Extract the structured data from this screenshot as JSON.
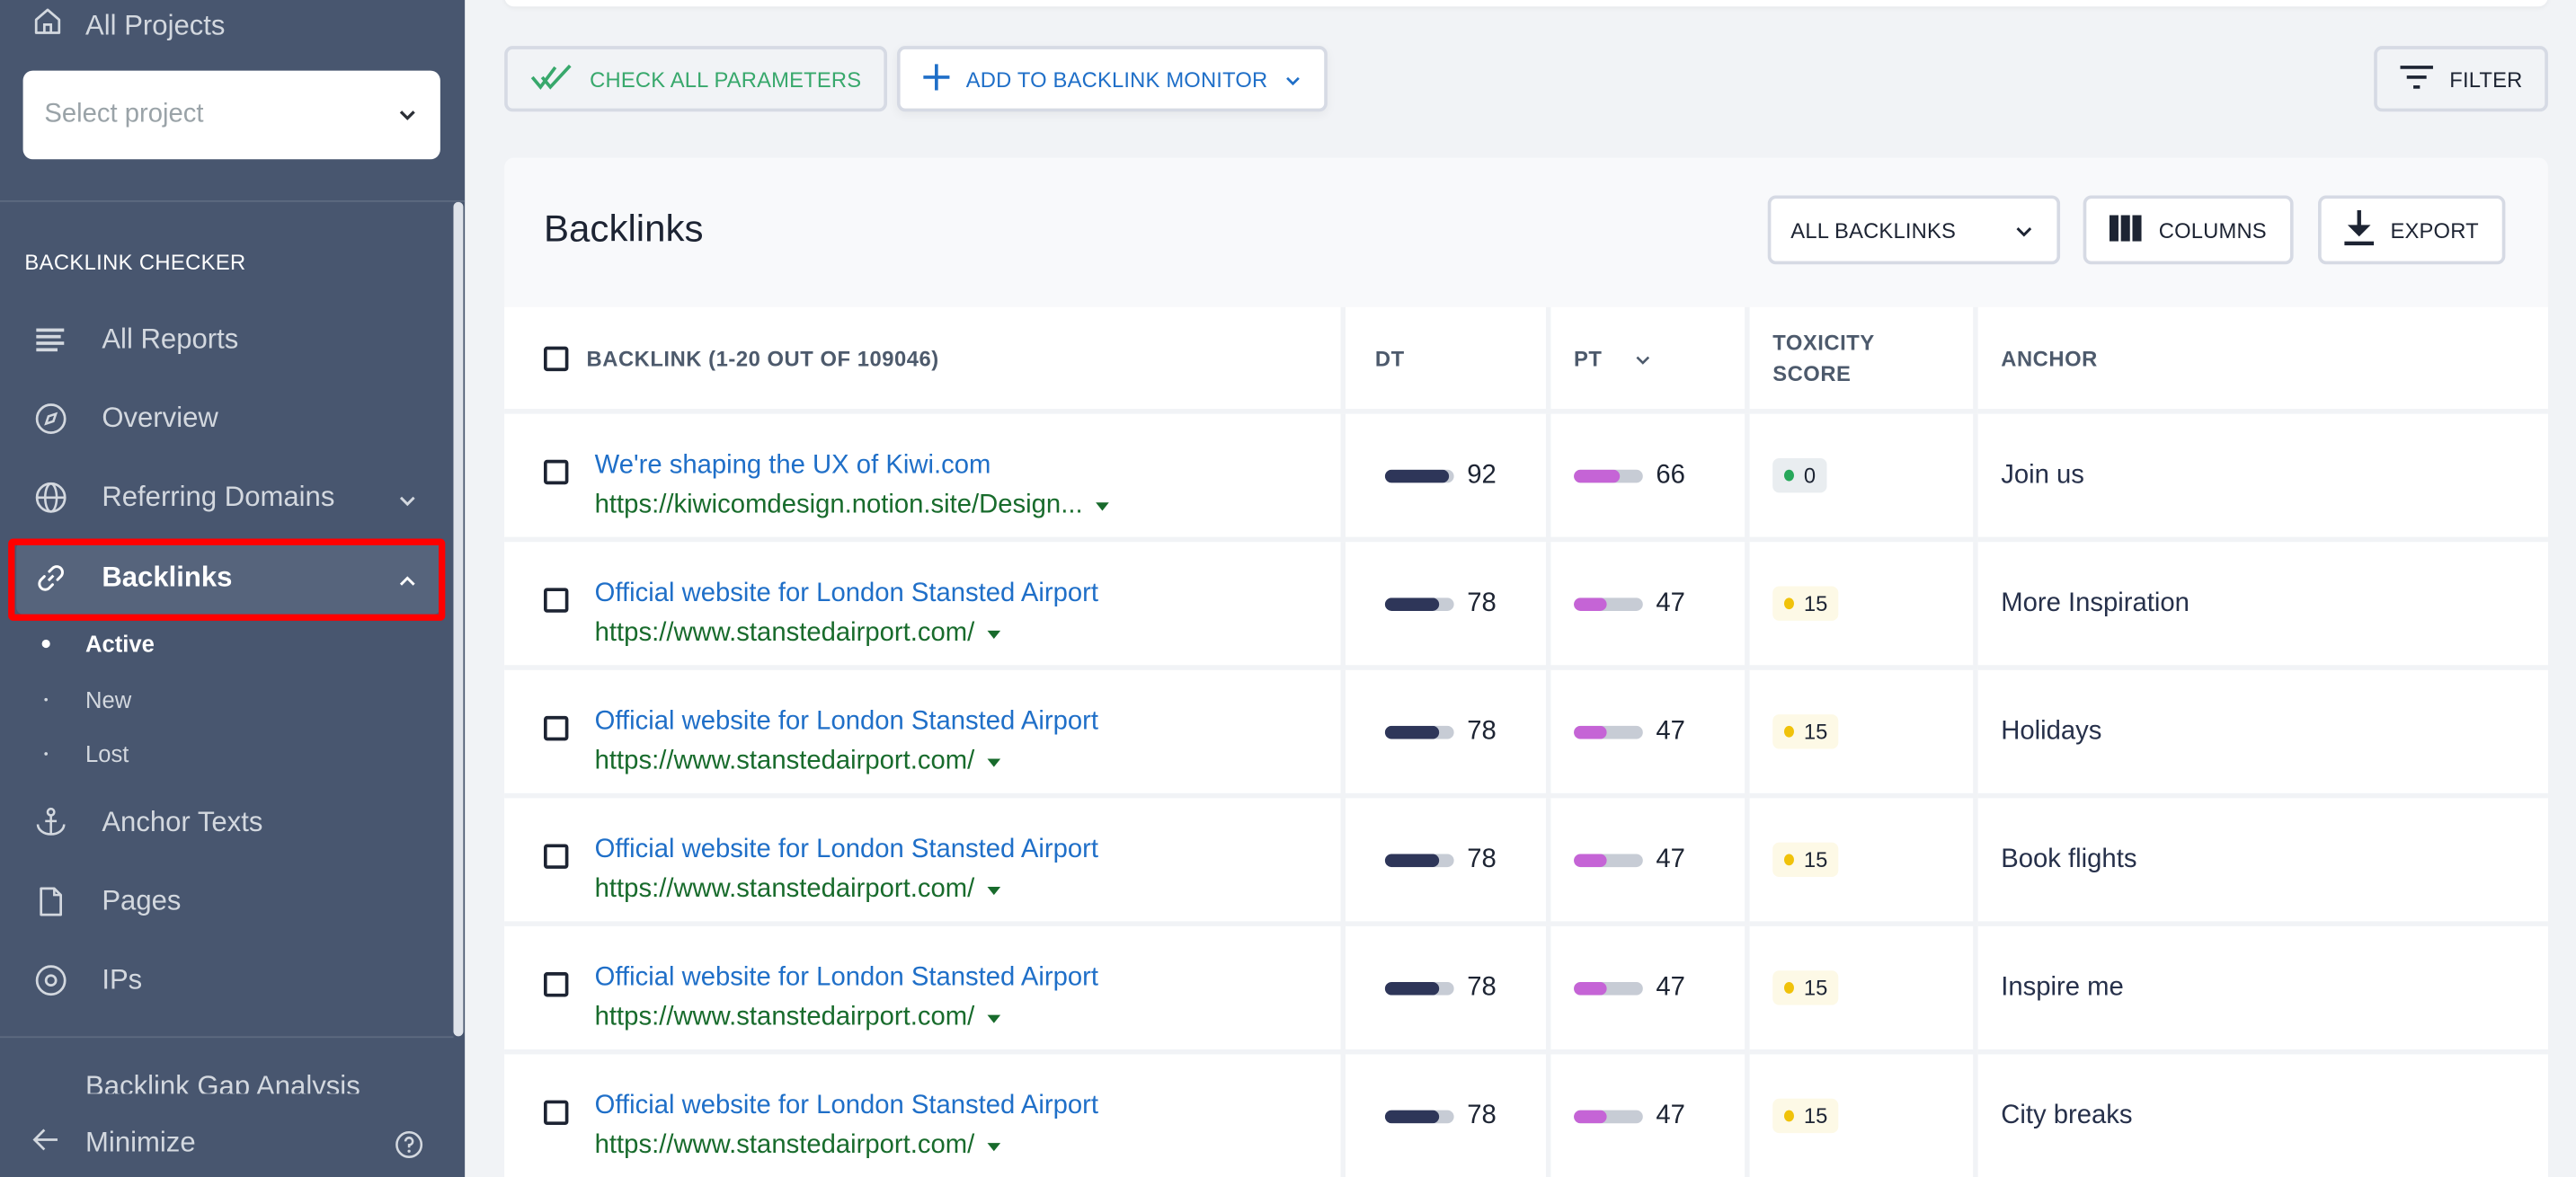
{
  "sidebar": {
    "all_projects": "All Projects",
    "select_project_placeholder": "Select project",
    "section_title": "BACKLINK CHECKER",
    "items": [
      {
        "label": "All Reports",
        "icon": "list-icon"
      },
      {
        "label": "Overview",
        "icon": "compass-icon"
      },
      {
        "label": "Referring Domains",
        "icon": "globe-icon"
      },
      {
        "label": "Backlinks",
        "icon": "link-icon"
      },
      {
        "label": "Anchor Texts",
        "icon": "anchor-icon"
      },
      {
        "label": "Pages",
        "icon": "page-icon"
      },
      {
        "label": "IPs",
        "icon": "target-icon"
      }
    ],
    "sub_items": [
      "Active",
      "New",
      "Lost"
    ],
    "cut_item": "Backlink Gap Analysis",
    "minimize": "Minimize"
  },
  "toolbar": {
    "check_all": "CHECK ALL PARAMETERS",
    "add_monitor": "ADD TO BACKLINK MONITOR",
    "filter": "FILTER"
  },
  "panel": {
    "title": "Backlinks",
    "view_select": "ALL BACKLINKS",
    "columns": "COLUMNS",
    "export": "EXPORT"
  },
  "table": {
    "headers": {
      "backlink": "BACKLINK (1-20 OUT OF 109046)",
      "dt": "DT",
      "pt": "PT",
      "toxicity_1": "TOXICITY",
      "toxicity_2": "SCORE",
      "anchor": "ANCHOR"
    },
    "rows": [
      {
        "title": "We're shaping the UX of Kiwi.com",
        "url": "https://kiwicomdesign.notion.site/Design...",
        "dt": 92,
        "pt": 66,
        "toxicity": "0",
        "tox_level": "green",
        "anchor": "Join us"
      },
      {
        "title": "Official website for London Stansted Airport",
        "url": "https://www.stanstedairport.com/",
        "dt": 78,
        "pt": 47,
        "toxicity": "15",
        "tox_level": "yellow",
        "anchor": "More Inspiration"
      },
      {
        "title": "Official website for London Stansted Airport",
        "url": "https://www.stanstedairport.com/",
        "dt": 78,
        "pt": 47,
        "toxicity": "15",
        "tox_level": "yellow",
        "anchor": "Holidays"
      },
      {
        "title": "Official website for London Stansted Airport",
        "url": "https://www.stanstedairport.com/",
        "dt": 78,
        "pt": 47,
        "toxicity": "15",
        "tox_level": "yellow",
        "anchor": "Book flights"
      },
      {
        "title": "Official website for London Stansted Airport",
        "url": "https://www.stanstedairport.com/",
        "dt": 78,
        "pt": 47,
        "toxicity": "15",
        "tox_level": "yellow",
        "anchor": "Inspire me"
      },
      {
        "title": "Official website for London Stansted Airport",
        "url": "https://www.stanstedairport.com/",
        "dt": 78,
        "pt": 47,
        "toxicity": "15",
        "tox_level": "yellow",
        "anchor": "City breaks"
      }
    ]
  },
  "colors": {
    "sidebar_bg": "#48566f",
    "dt_bar": "#2e3659",
    "pt_bar": "#c564d6",
    "tox_green_dot": "#27a75a",
    "tox_green_bg": "#e9edf0",
    "tox_yellow_dot": "#f0c20a",
    "tox_yellow_bg": "#fdf9e6",
    "link": "#1f6fc8",
    "url": "#186b2c",
    "highlight": "#ff0000"
  }
}
